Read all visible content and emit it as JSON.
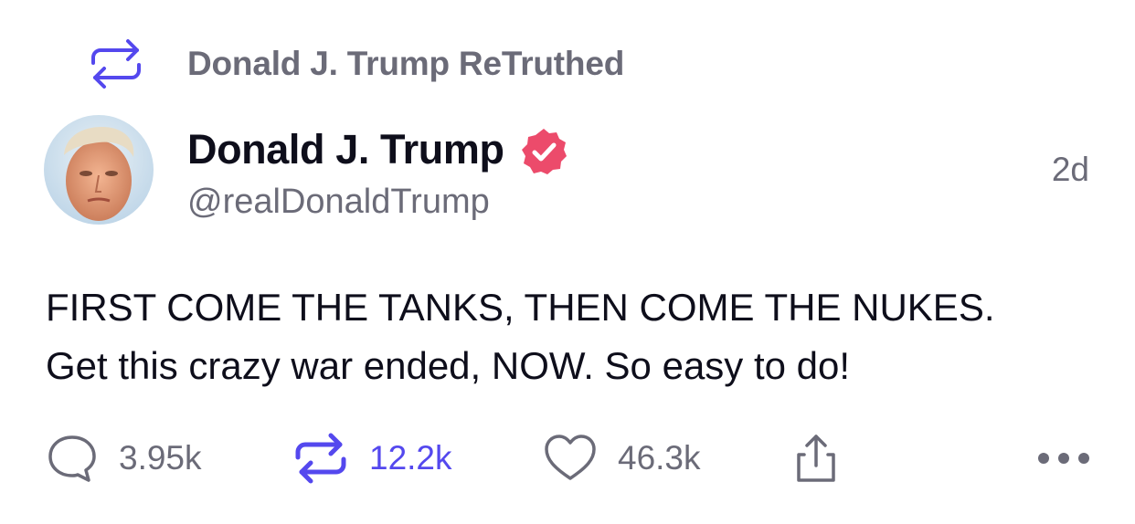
{
  "retruth": {
    "label": "Donald J. Trump ReTruthed",
    "icon": "retruth-icon"
  },
  "author": {
    "display_name": "Donald J. Trump",
    "handle": "@realDonaldTrump",
    "verified": true,
    "avatar": "avatar-photo"
  },
  "timestamp": "2d",
  "post": {
    "lines": [
      "FIRST COME THE TANKS, THEN COME THE NUKES.",
      "Get this crazy war ended, NOW. So easy to do!"
    ]
  },
  "actions": {
    "replies": "3.95k",
    "retruths": "12.2k",
    "likes": "46.3k"
  },
  "colors": {
    "accent": "#5448ee",
    "verified": "#ec4b6b",
    "muted": "#6b6b78",
    "text": "#0e0e1b"
  }
}
